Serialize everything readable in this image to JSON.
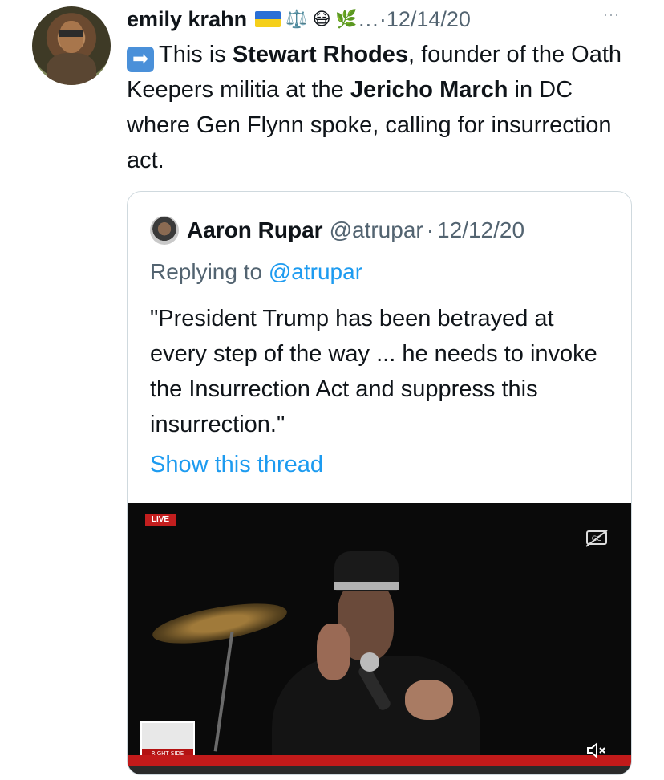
{
  "tweet": {
    "author_name": "emily krahn",
    "header_emojis": [
      "⚖️",
      "😷",
      "🌿"
    ],
    "header_ellipsis": "…",
    "date_sep": " · ",
    "date": "12/14/20",
    "more_menu": "···",
    "arrow_emoji": "➡",
    "text_parts": {
      "p1": "This is ",
      "b1": "Stewart Rhodes",
      "p2": ", founder of the Oath Keepers militia at the ",
      "b2": "Jericho March",
      "p3": " in DC where Gen Flynn spoke, calling for insurrection act."
    }
  },
  "quoted": {
    "author_name": "Aaron Rupar",
    "handle": "@atrupar",
    "date_sep": "·",
    "date": "12/12/20",
    "replying_prefix": "Replying to ",
    "replying_handle": "@atrupar",
    "text": "\"President Trump has been betrayed at every step of the way ... he needs to invoke the Insurrection Act and suppress this insurrection.\"",
    "show_thread": "Show this thread"
  },
  "video": {
    "live_badge": "LIVE",
    "logo_text": "RIGHT SIDE"
  },
  "colors": {
    "link": "#1d9bf0",
    "muted": "#536471",
    "border": "#cfd9de"
  }
}
